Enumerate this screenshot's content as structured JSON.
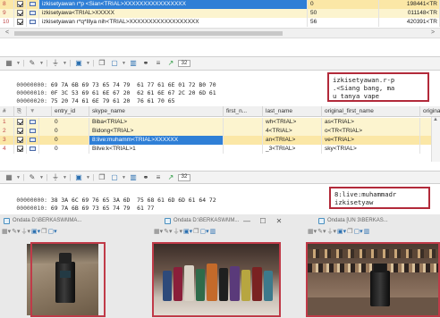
{
  "top_table": {
    "rows": [
      {
        "num": "8",
        "checked": true,
        "name": "izkisetyawan r*p <Sian<TRIAL>XXXXXXXXXXXXXXXX",
        "value": "0",
        "id": "198441<TR",
        "selected": true
      },
      {
        "num": "9",
        "checked": true,
        "name": "izkisetyawa<TRIAL>XXXXX",
        "value": "50",
        "id": "011148<TR",
        "selected": false
      },
      {
        "num": "10",
        "checked": true,
        "name": "izkisetyawan r*q*Illya nih<TRIAL>XXXXXXXXXXXXXXXXXX",
        "value": "56",
        "id": "420391<TR",
        "selected": false
      }
    ],
    "scroll_left": "<",
    "scroll_right": ">"
  },
  "toolbar1": {
    "icons": [
      "grid-icon",
      "pin-icon",
      "filter-icon",
      "image-icon",
      "copy-icon",
      "window-icon",
      "chart-icon",
      "binoculars-icon",
      "list-icon",
      "arrow-up-icon"
    ],
    "glyphs": [
      "▦",
      "✎",
      "⏚",
      "▣",
      "❐",
      "▢",
      "▥",
      "⚭",
      "≡",
      "↗"
    ],
    "num_label": "32"
  },
  "hex1": {
    "lines": [
      {
        "offset": "00000000:",
        "bytes1": "69 7A 6B 69 73 65 74 79",
        "bytes2": "61 77 61 6E 01 72 B0 70"
      },
      {
        "offset": "00000010:",
        "bytes1": "0F 3C 53 69 61 6E 67 20",
        "bytes2": "62 61 6E 67 2C 20 6D 61"
      },
      {
        "offset": "00000020:",
        "bytes1": "75 20 74 61 6E 79 61 20",
        "bytes2": "76 61 70 65"
      }
    ],
    "text": "izkisetyawan.r-p\n.<Siang bang, ma\nu tanya vape"
  },
  "mid_table": {
    "headers": [
      "#",
      "",
      "",
      "entry_id",
      "skype_name",
      "first_n...",
      "last_name",
      "original_first_name",
      "origina"
    ],
    "rows": [
      {
        "num": "1",
        "checked": true,
        "entry": "0",
        "skype": "Biba<TRIAL>",
        "last": "wh<TRIAL>",
        "orig": "as<TRIAL>",
        "selected": false
      },
      {
        "num": "2",
        "checked": true,
        "entry": "0",
        "skype": "Bidong<TRIAL>",
        "last": "4<TRIAL>",
        "orig": "o<TR<TRIAL>",
        "selected": false
      },
      {
        "num": "3",
        "checked": true,
        "entry": "0",
        "skype": "8:live:muhamm<TRIAL>XXXXXX",
        "last": "an<TRIAL>",
        "orig": "ve<TRIAL>",
        "selected": true
      },
      {
        "num": "4",
        "checked": true,
        "entry": "0",
        "skype": "Bilve:k<TRIAL>1",
        "last": "_3<TRIAL>",
        "orig": "sky<TRIAL>",
        "selected": false
      }
    ]
  },
  "toolbar2": {
    "glyphs": [
      "▦",
      "✎",
      "⏚",
      "▣",
      "❐",
      "▢",
      "▥",
      "⚭",
      "≡",
      "↗"
    ],
    "num_label": "32"
  },
  "hex2": {
    "lines": [
      {
        "offset": "00000000:",
        "bytes1": "38 3A 6C 69 76 65 3A 6D",
        "bytes2": "75 68 61 6D 6D 61 64 72"
      },
      {
        "offset": "00000010:",
        "bytes1": "69 7A 6B 69 73 65 74 79",
        "bytes2": "61 77"
      }
    ],
    "text": "8:live:muhammadr\nizkisetyaw"
  },
  "bottom_windows": [
    {
      "title": "Ondata D:\\BERKAS\\M\\IMA...",
      "controls": [
        "—",
        "☐",
        "✕"
      ]
    },
    {
      "title": "Ondata D:\\BERKAS\\M\\IM...",
      "controls": [
        "—",
        "☐",
        "✕"
      ]
    },
    {
      "title": "Ondata [UN 3\\BERKAS...",
      "controls": []
    }
  ],
  "colors": {
    "selected_row": "#fbe7a6",
    "alt_row": "#fcf4cf",
    "row_num": "#c04a4a",
    "highlight_box": "#b22a3a",
    "selected_blue": "#2f7fd6"
  }
}
